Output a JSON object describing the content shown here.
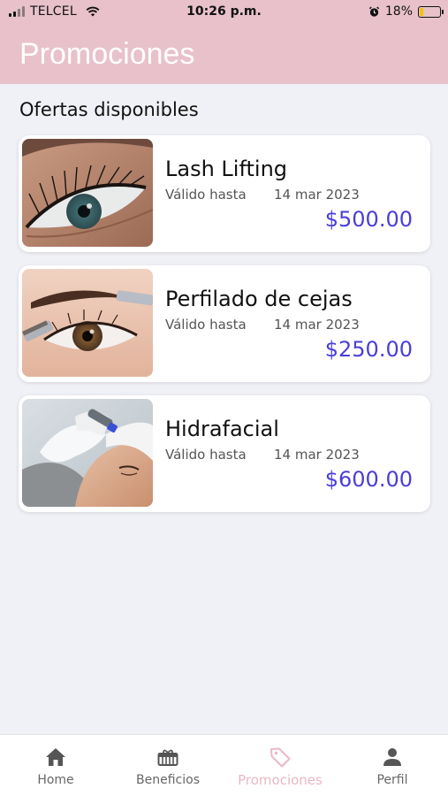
{
  "status_bar": {
    "carrier": "TELCEL",
    "time": "10:26 p.m.",
    "battery": "18%",
    "battery_level": 0.18
  },
  "header": {
    "title": "Promociones"
  },
  "section_title": "Ofertas disponibles",
  "offers": [
    {
      "title": "Lash Lifting",
      "valid_label": "Válido hasta",
      "date": "14 mar 2023",
      "price": "$500.00",
      "image": "eye-lashes-photo"
    },
    {
      "title": "Perfilado de cejas",
      "valid_label": "Válido hasta",
      "date": "14 mar 2023",
      "price": "$250.00",
      "image": "eyebrow-shaping-photo"
    },
    {
      "title": "Hidrafacial",
      "valid_label": "Válido hasta",
      "date": "14 mar 2023",
      "price": "$600.00",
      "image": "facial-treatment-photo"
    }
  ],
  "tabs": [
    {
      "label": "Home",
      "icon": "home-icon",
      "active": false
    },
    {
      "label": "Beneficios",
      "icon": "gift-icon",
      "active": false
    },
    {
      "label": "Promociones",
      "icon": "tag-icon",
      "active": true
    },
    {
      "label": "Perfil",
      "icon": "person-icon",
      "active": false
    }
  ],
  "colors": {
    "header_bg": "#e8c1cb",
    "price": "#4a3ed8",
    "active_tab": "#e8b8c6",
    "battery_fill": "#f2c200"
  }
}
